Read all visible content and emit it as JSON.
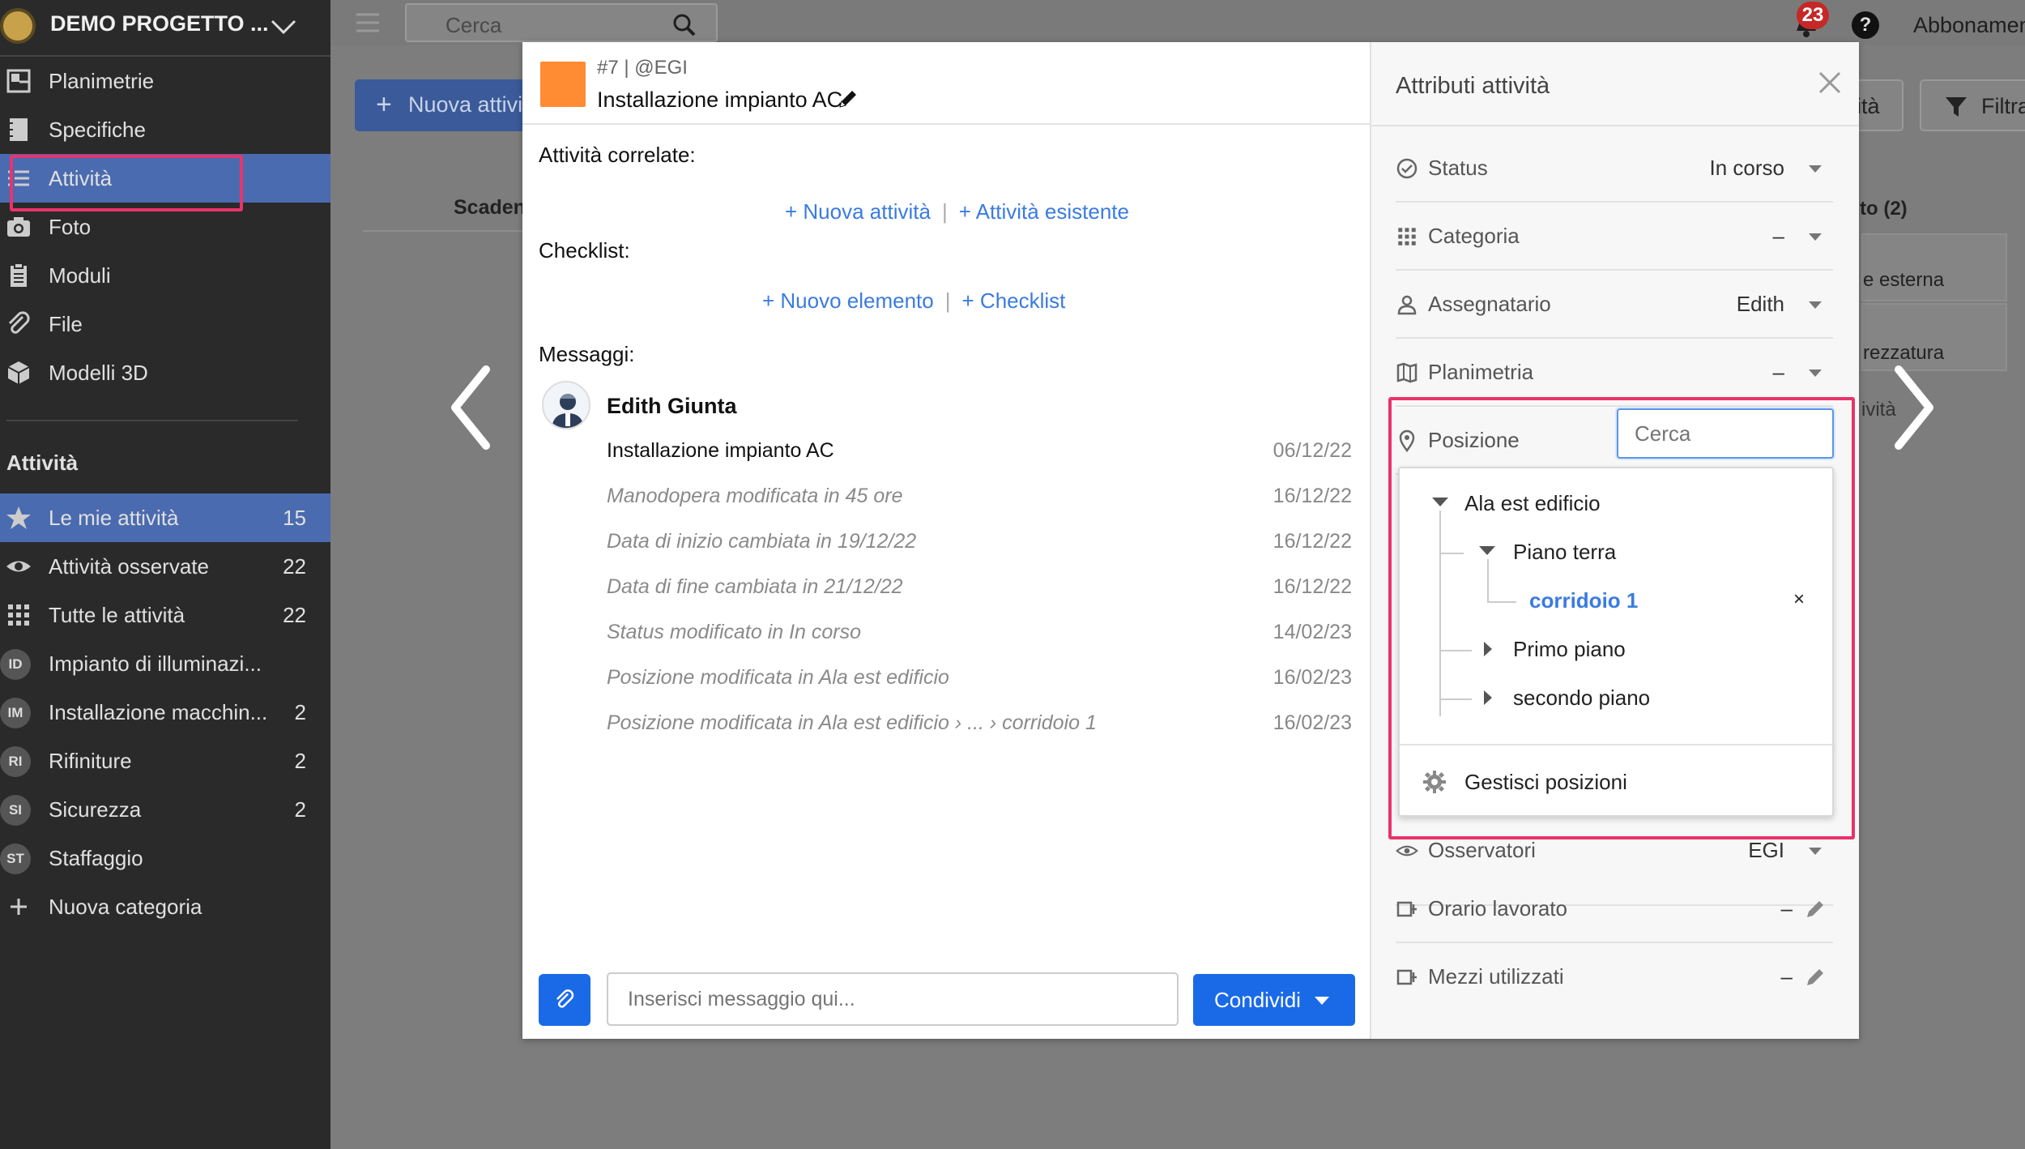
{
  "project": {
    "name": "DEMO PROGETTO ..."
  },
  "sidebar": {
    "nav": [
      {
        "label": "Planimetrie",
        "icon": "floorplan-icon"
      },
      {
        "label": "Specifiche",
        "icon": "notebook-icon"
      },
      {
        "label": "Attività",
        "icon": "list-icon",
        "active": true
      },
      {
        "label": "Foto",
        "icon": "camera-icon"
      },
      {
        "label": "Moduli",
        "icon": "clipboard-icon"
      },
      {
        "label": "File",
        "icon": "paperclip-icon"
      },
      {
        "label": "Modelli 3D",
        "icon": "cube-icon"
      }
    ],
    "section_title": "Attività",
    "activity_items": [
      {
        "label": "Le mie attività",
        "count": "15",
        "icon": "star-icon",
        "active": true
      },
      {
        "label": "Attività osservate",
        "count": "22",
        "icon": "eye-icon"
      },
      {
        "label": "Tutte le attività",
        "count": "22",
        "icon": "grid-icon"
      },
      {
        "label": "Impianto di illuminazi...",
        "count": "",
        "badge": "ID"
      },
      {
        "label": "Installazione macchin...",
        "count": "2",
        "badge": "IM"
      },
      {
        "label": "Rifiniture",
        "count": "2",
        "badge": "RI"
      },
      {
        "label": "Sicurezza",
        "count": "2",
        "badge": "SI"
      },
      {
        "label": "Staffaggio",
        "count": "",
        "badge": "ST"
      },
      {
        "label": "Nuova categoria",
        "count": "",
        "icon": "plus-icon"
      }
    ]
  },
  "topbar": {
    "search_placeholder": "Cerca",
    "notifications": "23",
    "help": "?",
    "subscription": "Abbonamen"
  },
  "background": {
    "new_activity_btn": "Nuova attivi",
    "scadenza": "Scaden",
    "filter_btn": "Filtra",
    "ita_btn": "ità",
    "col_header": "to (2)",
    "card1": "e esterna",
    "card2": "rezzatura",
    "card3": "ività"
  },
  "modal": {
    "id_line": "#7 | @EGI",
    "title": "Installazione impianto AC",
    "color": "#ff8c33",
    "related_title": "Attività correlate:",
    "related_links": [
      "+ Nuova attività",
      "+ Attività esistente"
    ],
    "checklist_title": "Checklist:",
    "checklist_links": [
      "+ Nuovo elemento",
      "+ Checklist"
    ],
    "messages_title": "Messaggi:",
    "author": "Edith Giunta",
    "messages": [
      {
        "text": "Installazione impianto AC",
        "date": "06/12/22",
        "style": "main"
      },
      {
        "text": "Manodopera modificata in 45 ore",
        "date": "16/12/22",
        "style": "it"
      },
      {
        "text": "Data di inizio cambiata in 19/12/22",
        "date": "16/12/22",
        "style": "it"
      },
      {
        "text": "Data di fine cambiata in 21/12/22",
        "date": "16/12/22",
        "style": "it"
      },
      {
        "text": "Status modificato in In corso",
        "date": "14/02/23",
        "style": "it"
      },
      {
        "text": "Posizione modificata in Ala est edificio",
        "date": "16/02/23",
        "style": "it"
      },
      {
        "text": "Posizione modificata in Ala est edificio › ... › corridoio 1",
        "date": "16/02/23",
        "style": "it"
      }
    ],
    "input_placeholder": "Inserisci messaggio qui...",
    "share_btn": "Condividi"
  },
  "attributes": {
    "title": "Attributi attività",
    "rows": [
      {
        "label": "Status",
        "value": "In corso",
        "icon": "check-circle-icon"
      },
      {
        "label": "Categoria",
        "value": "–",
        "icon": "grid-icon"
      },
      {
        "label": "Assegnatario",
        "value": "Edith",
        "icon": "user-icon"
      },
      {
        "label": "Planimetria",
        "value": "–",
        "icon": "map-icon"
      },
      {
        "label": "Posizione",
        "value": "",
        "icon": "pin-icon"
      },
      {
        "label": "Osservatori",
        "value": "EGI",
        "icon": "eye-icon"
      },
      {
        "label": "Orario lavorato",
        "value": "–",
        "icon": "clock-icon"
      },
      {
        "label": "Mezzi utilizzati",
        "value": "–",
        "icon": "tools-icon"
      }
    ],
    "position_search_placeholder": "Cerca"
  },
  "position_tree": {
    "nodes": [
      {
        "label": "Ala est edificio",
        "level": 0,
        "expanded": true
      },
      {
        "label": "Piano terra",
        "level": 1,
        "expanded": true
      },
      {
        "label": "corridoio 1",
        "level": 2,
        "selected": true
      },
      {
        "label": "Primo piano",
        "level": 1,
        "expanded": false
      },
      {
        "label": "secondo piano",
        "level": 1,
        "expanded": false
      }
    ],
    "clear_symbol": "×",
    "manage_label": "Gestisci posizioni"
  },
  "colors": {
    "accent": "#1a6ae8",
    "link": "#3a7be0",
    "highlight": "#e8336b",
    "sidebar_active": "#4a6bb0"
  }
}
